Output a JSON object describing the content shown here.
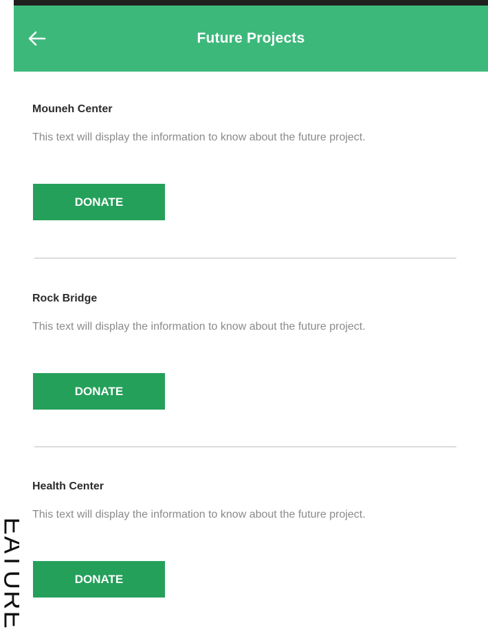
{
  "header": {
    "title": "Future Projects",
    "back_icon": "arrow-left-icon"
  },
  "projects": [
    {
      "name": "Mouneh Center",
      "description": "This text will display the information to know about the future project.",
      "button_label": "DONATE"
    },
    {
      "name": "Rock Bridge",
      "description": "This text will display the information to know about the future project.",
      "button_label": "DONATE"
    },
    {
      "name": "Health Center",
      "description": "This text will display the information to know about the future project.",
      "button_label": "DONATE"
    }
  ],
  "side_label": "EATURE",
  "colors": {
    "header": "#3db87b",
    "button": "#24a05a",
    "divider": "#dcdcdc"
  }
}
